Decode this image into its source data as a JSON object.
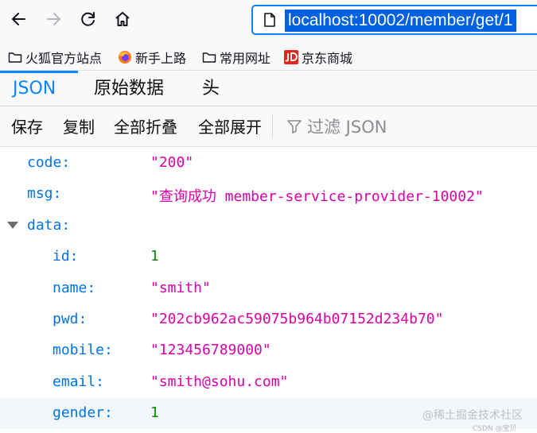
{
  "browser": {
    "url": "localhost:10002/member/get/1",
    "bookmarks": [
      {
        "label": "火狐官方站点",
        "icon": "folder-icon"
      },
      {
        "label": "新手上路",
        "icon": "firefox-icon"
      },
      {
        "label": "常用网址",
        "icon": "folder-icon"
      },
      {
        "label": "京东商城",
        "icon": "jd-icon"
      }
    ]
  },
  "viewer": {
    "tabs": [
      {
        "label": "JSON",
        "selected": true
      },
      {
        "label": "原始数据",
        "selected": false
      },
      {
        "label": "头",
        "selected": false
      }
    ],
    "toolbar": {
      "save": "保存",
      "copy": "复制",
      "collapse_all": "全部折叠",
      "expand_all": "全部展开",
      "filter_placeholder": "过滤 JSON"
    }
  },
  "json": {
    "code": {
      "key": "code:",
      "value": "\"200\""
    },
    "msg": {
      "key": "msg:",
      "value": "\"查询成功 member-service-provider-10002\""
    },
    "data": {
      "key": "data:",
      "expanded": true,
      "fields": [
        {
          "key": "id:",
          "value": "1",
          "type": "number"
        },
        {
          "key": "name:",
          "value": "\"smith\"",
          "type": "string"
        },
        {
          "key": "pwd:",
          "value": "\"202cb962ac59075b964b07152d234b70\"",
          "type": "string"
        },
        {
          "key": "mobile:",
          "value": "\"123456789000\"",
          "type": "string"
        },
        {
          "key": "email:",
          "value": "\"smith@sohu.com\"",
          "type": "string"
        },
        {
          "key": "gender:",
          "value": "1",
          "type": "number"
        }
      ]
    }
  },
  "watermark": "@稀土掘金技术社区",
  "watermark_small": "CSDN @宝贝",
  "colors": {
    "accent": "#0a84ff",
    "json_key": "#0074e8",
    "json_string": "#dd00a9",
    "json_number": "#058b00"
  }
}
